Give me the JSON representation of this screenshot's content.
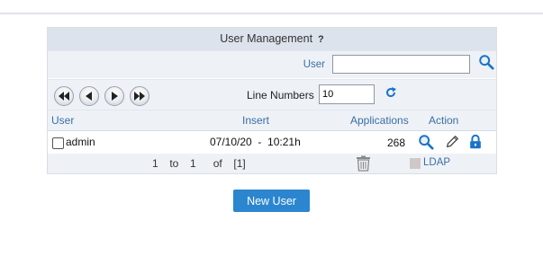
{
  "panel": {
    "title": "User Management",
    "help_symbol": "?"
  },
  "search": {
    "label": "User",
    "value": ""
  },
  "navigation": {
    "line_numbers_label": "Line Numbers",
    "line_numbers_value": "10",
    "buttons": [
      "first-page",
      "previous-page",
      "next-page",
      "last-page"
    ]
  },
  "table": {
    "columns": [
      "User",
      "Insert",
      "Applications",
      "Action"
    ],
    "rows": [
      {
        "user": "admin",
        "insert": "07/10/20  -  10:21h",
        "applications": "268"
      }
    ],
    "actions": [
      "search-icon",
      "edit-pencil-icon",
      "lock-icon"
    ]
  },
  "footer": {
    "pager_text": "1  to  1   of  [1]",
    "ldap_label": "LDAP"
  },
  "new_user_button": "New User",
  "colors": {
    "accent": "#2b86cf",
    "link": "#3a6ea5",
    "header_bg": "#dde3ec",
    "row_bg": "#eef2f7"
  }
}
